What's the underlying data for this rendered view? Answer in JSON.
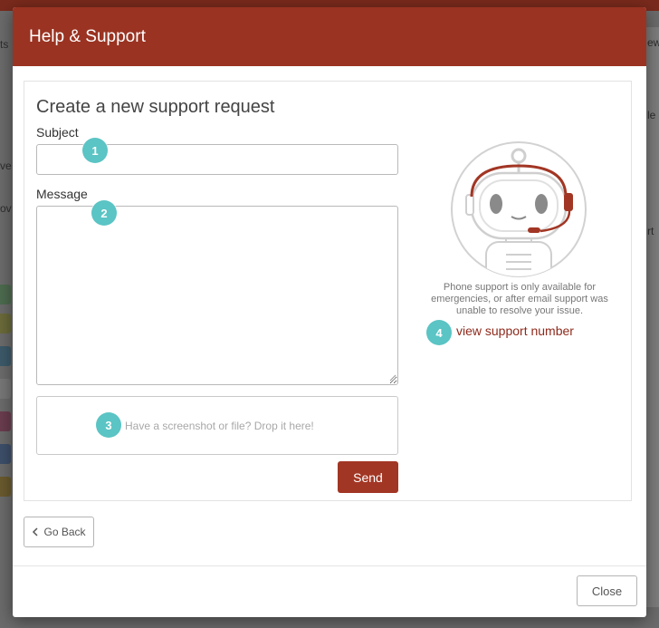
{
  "modal": {
    "title": "Help & Support",
    "form": {
      "heading": "Create a new support request",
      "subject_label": "Subject",
      "subject_value": "",
      "message_label": "Message",
      "message_value": "",
      "dropzone_text": "Have a screenshot or file? Drop it here!",
      "send_label": "Send"
    },
    "phone": {
      "note": "Phone support is only available for emergencies, or after email support was unable to resolve your issue.",
      "link_label": "view support number"
    },
    "badges": [
      "1",
      "2",
      "3",
      "4"
    ],
    "go_back_label": "Go Back",
    "close_label": "Close"
  },
  "background": {
    "fragments": [
      "ts",
      "ve",
      "ov",
      "ew",
      "le",
      "rt"
    ]
  },
  "colors": {
    "header": "#9a3322",
    "send_button": "#a23624",
    "badge": "#5bc4c4",
    "link": "#8e2a1c"
  },
  "icons": {
    "robot": "robot-mascot-illustration",
    "go_back": "chevron-left-icon",
    "resize": "resize-grip-icon"
  }
}
